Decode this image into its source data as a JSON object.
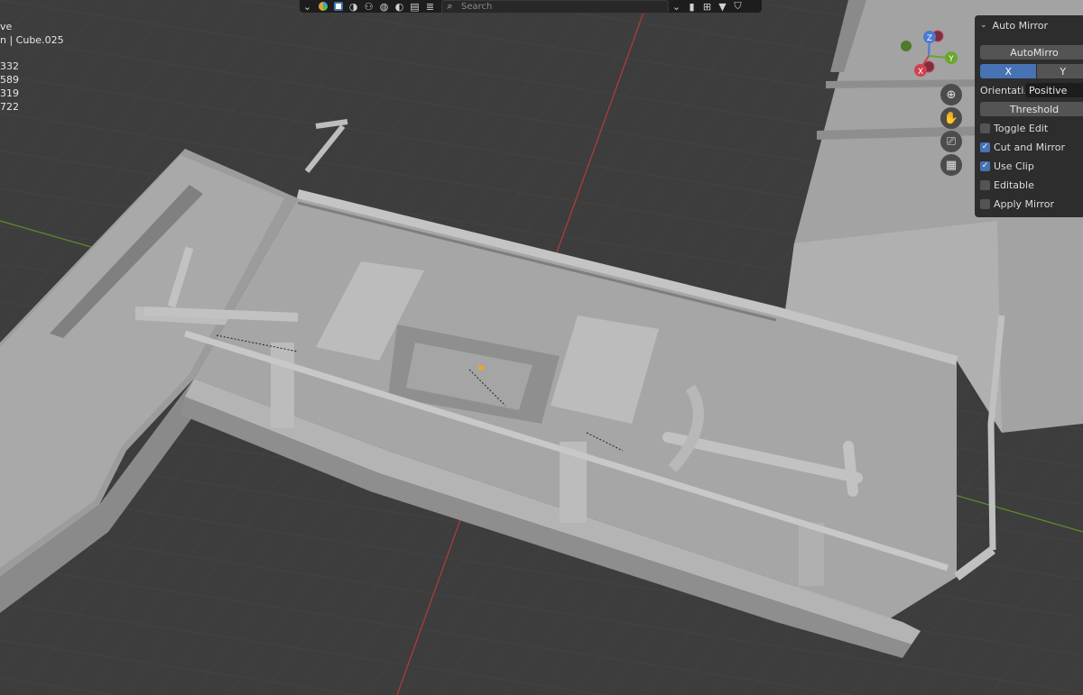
{
  "stats": {
    "lines": [
      "ve",
      "n | Cube.025",
      "",
      "332",
      "589",
      "319",
      "722"
    ]
  },
  "toolbar": {
    "search_placeholder": "Search"
  },
  "gizmo": {
    "z": "Z",
    "y": "Y",
    "x": "X"
  },
  "panel": {
    "title": "Auto Mirror",
    "automirror_button": "AutoMirro",
    "axis_x": "X",
    "axis_y": "Y",
    "orientation_label": "Orientati...",
    "orientation_value": "Positive",
    "threshold": "Threshold",
    "options": [
      {
        "label": "Toggle Edit",
        "checked": false
      },
      {
        "label": "Cut and Mirror",
        "checked": true
      },
      {
        "label": "Use Clip",
        "checked": true
      },
      {
        "label": "Editable",
        "checked": false
      },
      {
        "label": "Apply Mirror",
        "checked": false
      }
    ]
  },
  "colors": {
    "viewport_bg": "#3d3d3d",
    "axis_x_line": "#c83c3c",
    "axis_y_line": "#6a9a2a",
    "accent": "#4772b3",
    "model": "#a8a8a8"
  }
}
